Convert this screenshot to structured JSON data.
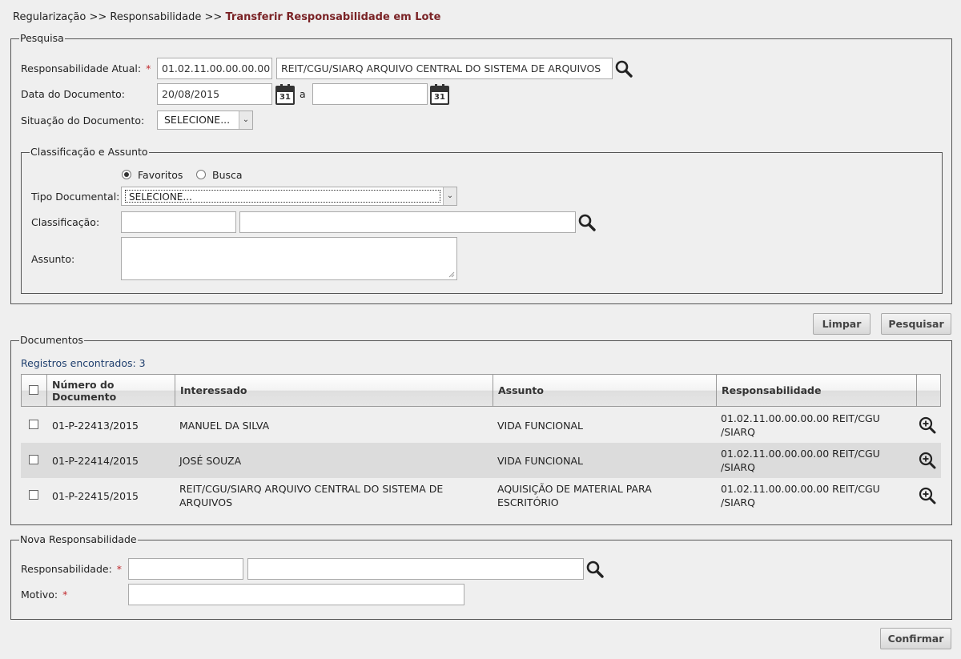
{
  "breadcrumb": {
    "item1": "Regularização",
    "sep": ">>",
    "item2": "Responsabilidade",
    "current": "Transferir Responsabilidade em Lote"
  },
  "pesquisa": {
    "legend": "Pesquisa",
    "resp_label": "Responsabilidade Atual:",
    "resp_code": "01.02.11.00.00.00.00",
    "resp_name": "REIT/CGU/SIARQ ARQUIVO CENTRAL DO SISTEMA DE ARQUIVOS",
    "data_label": "Data do Documento:",
    "data_from": "20/08/2015",
    "data_sep": "a",
    "data_to": "",
    "cal_day": "31",
    "situacao_label": "Situação do Documento:",
    "situacao_value": "SELECIONE...",
    "classif": {
      "legend": "Classificação e Assunto",
      "radio_favoritos": "Favoritos",
      "radio_busca": "Busca",
      "tipo_label": "Tipo Documental:",
      "tipo_value": "SELECIONE...",
      "classif_label": "Classificação:",
      "classif_code": "",
      "classif_name": "",
      "assunto_label": "Assunto:",
      "assunto_value": ""
    }
  },
  "actions": {
    "limpar": "Limpar",
    "pesquisar": "Pesquisar",
    "confirmar": "Confirmar"
  },
  "documentos": {
    "legend": "Documentos",
    "count": "Registros encontrados: 3",
    "columns": [
      "Número do Documento",
      "Interessado",
      "Assunto",
      "Responsabilidade"
    ],
    "rows": [
      {
        "numero": "01-P-22413/2015",
        "interessado": "MANUEL DA SILVA",
        "assunto": "VIDA FUNCIONAL",
        "responsabilidade": "01.02.11.00.00.00.00 REIT/CGU /SIARQ"
      },
      {
        "numero": "01-P-22414/2015",
        "interessado": "JOSÉ SOUZA",
        "assunto": "VIDA FUNCIONAL",
        "responsabilidade": "01.02.11.00.00.00.00 REIT/CGU /SIARQ"
      },
      {
        "numero": "01-P-22415/2015",
        "interessado": "REIT/CGU/SIARQ ARQUIVO CENTRAL DO SISTEMA DE ARQUIVOS",
        "assunto": "AQUISIÇÃO DE MATERIAL PARA ESCRITÓRIO",
        "responsabilidade": "01.02.11.00.00.00.00 REIT/CGU /SIARQ"
      }
    ]
  },
  "nova": {
    "legend": "Nova Responsabilidade",
    "resp_label": "Responsabilidade:",
    "resp_code": "",
    "resp_name": "",
    "motivo_label": "Motivo:",
    "motivo_value": ""
  },
  "required_mark": "*",
  "icons": {
    "search": "search-icon",
    "calendar": "calendar-icon",
    "zoom": "zoom-in-icon",
    "dropdown": "chevron-down-icon"
  }
}
